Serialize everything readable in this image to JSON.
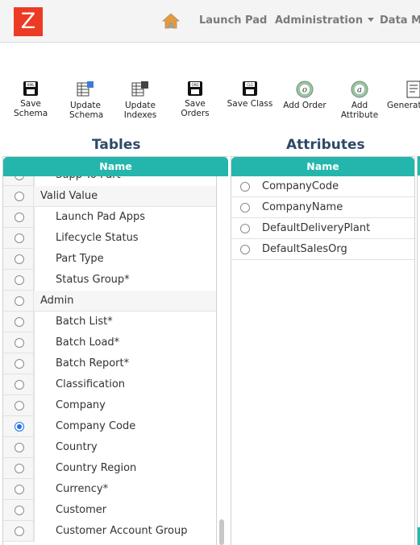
{
  "header": {
    "logo_letter": "Z",
    "nav": {
      "launch_pad": "Launch Pad",
      "administration": "Administration",
      "data_ma": "Data Ma"
    }
  },
  "toolbar": {
    "buttons": [
      {
        "label": "Save\nSchema",
        "icon": "save-schema-icon"
      },
      {
        "label": "Update\nSchema",
        "icon": "update-schema-icon"
      },
      {
        "label": "Update\nIndexes",
        "icon": "update-indexes-icon"
      },
      {
        "label": "Save Orders",
        "icon": "save-orders-icon"
      },
      {
        "label": "Save Class",
        "icon": "save-class-icon"
      },
      {
        "label": "Add Order",
        "icon": "add-order-icon"
      },
      {
        "label": "Add Attribute",
        "icon": "add-attribute-icon"
      },
      {
        "label": "Generat",
        "icon": "generate-icon"
      }
    ]
  },
  "tables": {
    "title": "Tables",
    "column_header": "Name",
    "rows": [
      {
        "name": "Supp To Part*",
        "level": "child",
        "selected": false
      },
      {
        "name": "Valid Value",
        "level": "parent",
        "selected": false
      },
      {
        "name": "Launch Pad Apps",
        "level": "child",
        "selected": false
      },
      {
        "name": "Lifecycle Status",
        "level": "child",
        "selected": false
      },
      {
        "name": "Part Type",
        "level": "child",
        "selected": false
      },
      {
        "name": "Status Group*",
        "level": "child",
        "selected": false
      },
      {
        "name": "Admin",
        "level": "parent",
        "selected": false
      },
      {
        "name": "Batch List*",
        "level": "child",
        "selected": false
      },
      {
        "name": "Batch Load*",
        "level": "child",
        "selected": false
      },
      {
        "name": "Batch Report*",
        "level": "child",
        "selected": false
      },
      {
        "name": "Classification",
        "level": "child",
        "selected": false
      },
      {
        "name": "Company",
        "level": "child",
        "selected": false
      },
      {
        "name": "Company Code",
        "level": "child",
        "selected": true
      },
      {
        "name": "Country",
        "level": "child",
        "selected": false
      },
      {
        "name": "Country Region",
        "level": "child",
        "selected": false
      },
      {
        "name": "Currency*",
        "level": "child",
        "selected": false
      },
      {
        "name": "Customer",
        "level": "child",
        "selected": false
      },
      {
        "name": "Customer Account Group",
        "level": "child",
        "selected": false
      }
    ]
  },
  "attributes": {
    "title": "Attributes",
    "column_header": "Name",
    "rows": [
      {
        "name": "CompanyCode"
      },
      {
        "name": "CompanyName"
      },
      {
        "name": "DefaultDeliveryPlant"
      },
      {
        "name": "DefaultSalesOrg"
      }
    ]
  },
  "colors": {
    "accent_teal": "#24b6ad",
    "logo_red": "#ec3b24",
    "title_navy": "#2f4a68"
  }
}
